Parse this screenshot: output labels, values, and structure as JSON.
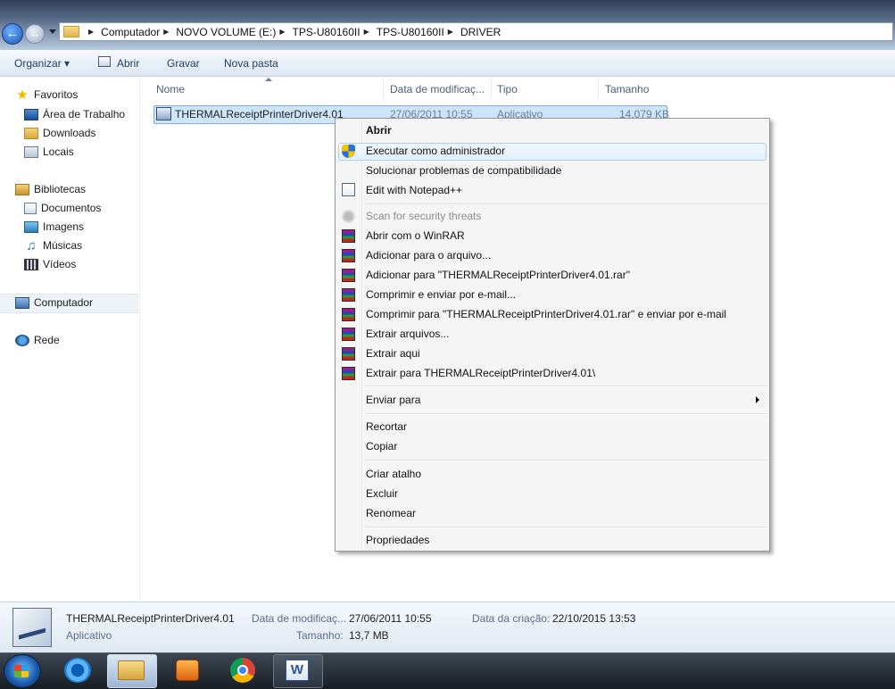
{
  "address_bar": {
    "breadcrumbs": [
      "Computador",
      "NOVO VOLUME (E:)",
      "TPS-U80160II",
      "TPS-U80160II",
      "DRIVER"
    ]
  },
  "toolbar": {
    "organizar": "Organizar",
    "abrir": "Abrir",
    "gravar": "Gravar",
    "nova_pasta": "Nova pasta"
  },
  "sidebar": {
    "favoritos": "Favoritos",
    "area_trabalho": "Área de Trabalho",
    "downloads": "Downloads",
    "locais": "Locais",
    "bibliotecas": "Bibliotecas",
    "documentos": "Documentos",
    "imagens": "Imagens",
    "musicas": "Músicas",
    "videos": "Vídeos",
    "computador": "Computador",
    "rede": "Rede"
  },
  "columns": {
    "nome": "Nome",
    "data": "Data de modificaç...",
    "tipo": "Tipo",
    "tamanho": "Tamanho"
  },
  "file": {
    "name": "THERMALReceiptPrinterDriver4.01",
    "date": "27/06/2011 10:55",
    "type": "Aplicativo",
    "size": "14.079 KB"
  },
  "context_menu": {
    "abrir": "Abrir",
    "executar_admin": "Executar como administrador",
    "solucionar": "Solucionar problemas de compatibilidade",
    "notepad": "Edit with Notepad++",
    "scan": "Scan for security threats",
    "abrir_winrar": "Abrir com o WinRAR",
    "adicionar_arquivo": "Adicionar para o arquivo...",
    "adicionar_rar": "Adicionar para \"THERMALReceiptPrinterDriver4.01.rar\"",
    "comprimir_email": "Comprimir e enviar por e-mail...",
    "comprimir_rar_email": "Comprimir para \"THERMALReceiptPrinterDriver4.01.rar\" e enviar por e-mail",
    "extrair_arquivos": "Extrair arquivos...",
    "extrair_aqui": "Extrair aqui",
    "extrair_para": "Extrair para THERMALReceiptPrinterDriver4.01\\",
    "enviar_para": "Enviar para",
    "recortar": "Recortar",
    "copiar": "Copiar",
    "criar_atalho": "Criar atalho",
    "excluir": "Excluir",
    "renomear": "Renomear",
    "propriedades": "Propriedades"
  },
  "details": {
    "name": "THERMALReceiptPrinterDriver4.01",
    "type": "Aplicativo",
    "date_label": "Data de modificaç...",
    "date_value": "27/06/2011 10:55",
    "size_label": "Tamanho:",
    "size_value": "13,7 MB",
    "created_label": "Data da criação:",
    "created_value": "22/10/2015 13:53"
  }
}
